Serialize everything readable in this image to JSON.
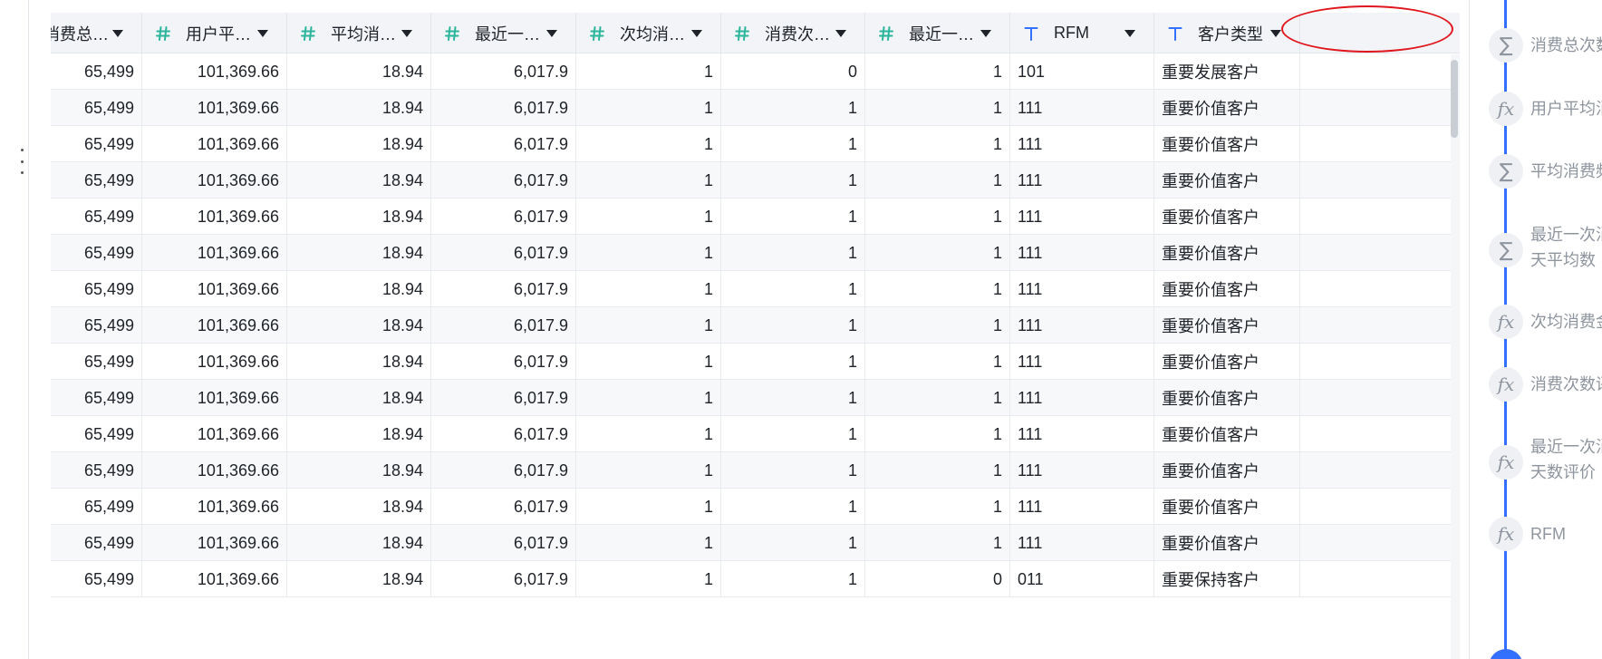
{
  "columns": [
    {
      "label": "消费总…",
      "type": "number"
    },
    {
      "label": "用户平…",
      "type": "number"
    },
    {
      "label": "平均消…",
      "type": "number"
    },
    {
      "label": "最近一…",
      "type": "number"
    },
    {
      "label": "次均消…",
      "type": "number"
    },
    {
      "label": "消费次…",
      "type": "number"
    },
    {
      "label": "最近一…",
      "type": "number"
    },
    {
      "label": "RFM",
      "type": "text"
    },
    {
      "label": "客户类型",
      "type": "text"
    }
  ],
  "rows": [
    [
      "65,499",
      "101,369.66",
      "18.94",
      "6,017.9",
      "1",
      "0",
      "1",
      "101",
      "重要发展客户"
    ],
    [
      "65,499",
      "101,369.66",
      "18.94",
      "6,017.9",
      "1",
      "1",
      "1",
      "111",
      "重要价值客户"
    ],
    [
      "65,499",
      "101,369.66",
      "18.94",
      "6,017.9",
      "1",
      "1",
      "1",
      "111",
      "重要价值客户"
    ],
    [
      "65,499",
      "101,369.66",
      "18.94",
      "6,017.9",
      "1",
      "1",
      "1",
      "111",
      "重要价值客户"
    ],
    [
      "65,499",
      "101,369.66",
      "18.94",
      "6,017.9",
      "1",
      "1",
      "1",
      "111",
      "重要价值客户"
    ],
    [
      "65,499",
      "101,369.66",
      "18.94",
      "6,017.9",
      "1",
      "1",
      "1",
      "111",
      "重要价值客户"
    ],
    [
      "65,499",
      "101,369.66",
      "18.94",
      "6,017.9",
      "1",
      "1",
      "1",
      "111",
      "重要价值客户"
    ],
    [
      "65,499",
      "101,369.66",
      "18.94",
      "6,017.9",
      "1",
      "1",
      "1",
      "111",
      "重要价值客户"
    ],
    [
      "65,499",
      "101,369.66",
      "18.94",
      "6,017.9",
      "1",
      "1",
      "1",
      "111",
      "重要价值客户"
    ],
    [
      "65,499",
      "101,369.66",
      "18.94",
      "6,017.9",
      "1",
      "1",
      "1",
      "111",
      "重要价值客户"
    ],
    [
      "65,499",
      "101,369.66",
      "18.94",
      "6,017.9",
      "1",
      "1",
      "1",
      "111",
      "重要价值客户"
    ],
    [
      "65,499",
      "101,369.66",
      "18.94",
      "6,017.9",
      "1",
      "1",
      "1",
      "111",
      "重要价值客户"
    ],
    [
      "65,499",
      "101,369.66",
      "18.94",
      "6,017.9",
      "1",
      "1",
      "1",
      "111",
      "重要价值客户"
    ],
    [
      "65,499",
      "101,369.66",
      "18.94",
      "6,017.9",
      "1",
      "1",
      "1",
      "111",
      "重要价值客户"
    ],
    [
      "65,499",
      "101,369.66",
      "18.94",
      "6,017.9",
      "1",
      "1",
      "0",
      "011",
      "重要保持客户"
    ]
  ],
  "steps": [
    {
      "kind": "sum",
      "lines": [
        "消费总次数"
      ]
    },
    {
      "kind": "fx",
      "lines": [
        "用户平均消"
      ]
    },
    {
      "kind": "sum",
      "lines": [
        "平均消费频"
      ]
    },
    {
      "kind": "sum",
      "lines": [
        "最近一次消",
        "天平均数"
      ]
    },
    {
      "kind": "fx",
      "lines": [
        "次均消费金"
      ]
    },
    {
      "kind": "fx",
      "lines": [
        "消费次数评"
      ]
    },
    {
      "kind": "fx",
      "lines": [
        "最近一次消",
        "天数评价"
      ]
    },
    {
      "kind": "fx",
      "lines": [
        "RFM"
      ]
    }
  ],
  "icons": {
    "number_type": "hash-icon",
    "text_type": "text-type-icon",
    "dropdown": "caret-down-icon",
    "sum": "sigma-icon",
    "formula": "fx-icon"
  },
  "colors": {
    "number_icon": "#2bb59a",
    "text_icon": "#3370ff",
    "highlight": "#e0161e",
    "timeline": "#3370ff"
  }
}
